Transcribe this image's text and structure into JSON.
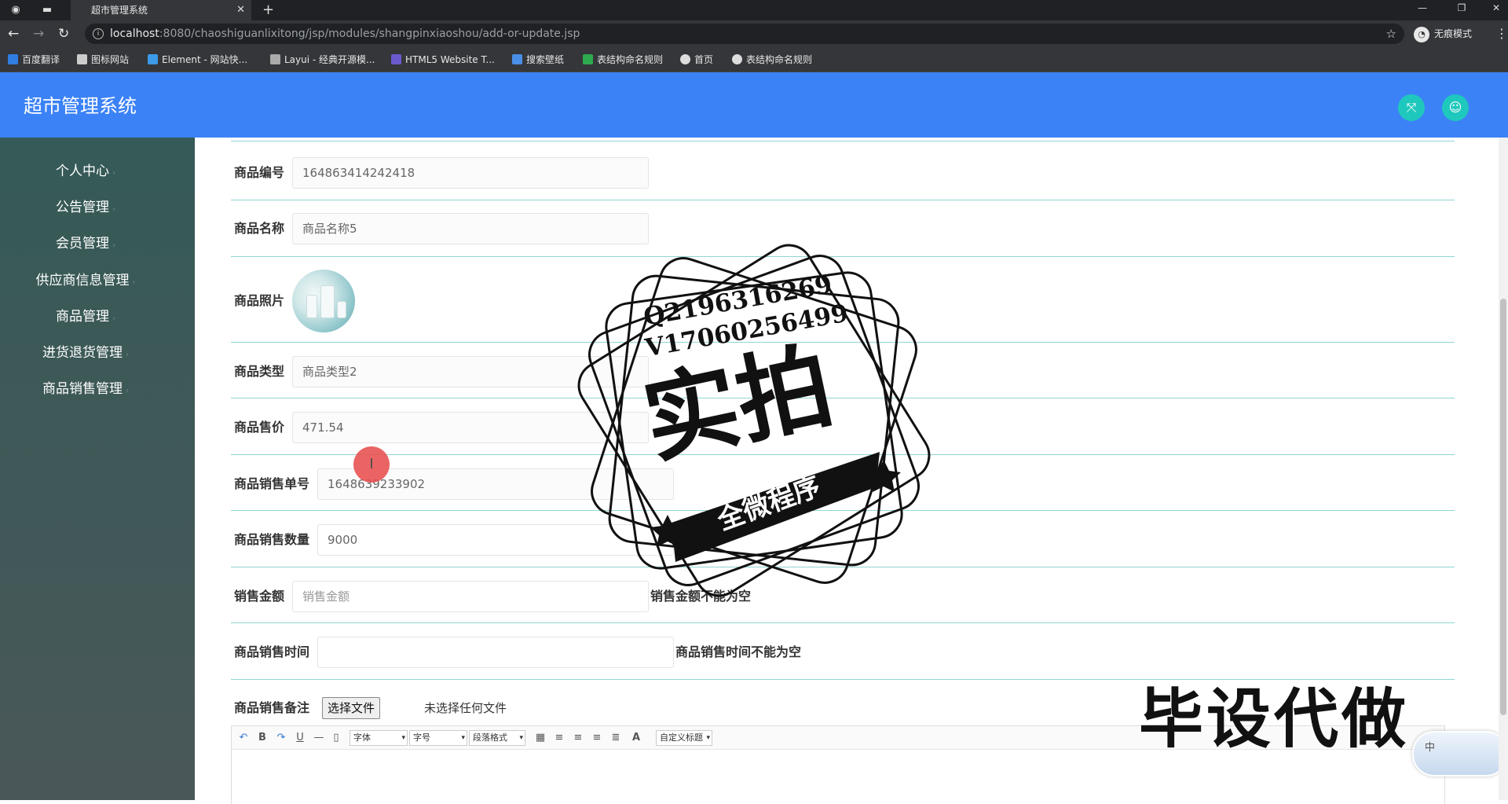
{
  "browser": {
    "tab_title": "超市管理系统",
    "tab_close": "✕",
    "url_host": "localhost",
    "url_rest": ":8080/chaoshiguanlixitong/jsp/modules/shangpinxiaoshou/add-or-update.jsp",
    "profile_label": "无痕模式",
    "bookmarks": [
      {
        "label": "百度翻译",
        "color": "#2f7de1"
      },
      {
        "label": "图标网站",
        "color": "#cccccc"
      },
      {
        "label": "Element - 网站快...",
        "color": "#3d9be9"
      },
      {
        "label": "Layui - 经典开源模...",
        "color": "#aaaaaa"
      },
      {
        "label": "HTML5 Website T...",
        "color": "#6a5acd"
      },
      {
        "label": "搜索壁纸",
        "color": "#4a8fe7"
      },
      {
        "label": "表结构命名规则",
        "color": "#2eaa4f"
      },
      {
        "label": "首页",
        "color": "#dddddd"
      },
      {
        "label": "表结构命名规则",
        "color": "#dddddd"
      }
    ]
  },
  "header": {
    "title": "超市管理系统",
    "accent": "#3b82f6",
    "button_color": "#1fc8bd"
  },
  "sidebar": {
    "items": [
      {
        "label": "个人中心"
      },
      {
        "label": "公告管理"
      },
      {
        "label": "会员管理"
      },
      {
        "label": "供应商信息管理"
      },
      {
        "label": "商品管理"
      },
      {
        "label": "进货退货管理"
      },
      {
        "label": "商品销售管理"
      }
    ]
  },
  "form": {
    "product_code": {
      "label": "商品编号",
      "value": "164863414242418"
    },
    "product_name": {
      "label": "商品名称",
      "value": "商品名称5"
    },
    "product_photo": {
      "label": "商品照片"
    },
    "product_type": {
      "label": "商品类型",
      "value": "商品类型2"
    },
    "product_price": {
      "label": "商品售价",
      "value": "471.54"
    },
    "sale_order_no": {
      "label": "商品销售单号",
      "value": "1648639233902"
    },
    "sale_quantity": {
      "label": "商品销售数量",
      "value": "9000"
    },
    "sale_amount": {
      "label": "销售金额",
      "placeholder": "销售金额",
      "error": "销售金额不能为空"
    },
    "sale_time": {
      "label": "商品销售时间",
      "value": "",
      "error": "商品销售时间不能为空"
    },
    "sale_remark": {
      "label": "商品销售备注",
      "file_button": "选择文件",
      "file_status": "未选择任何文件"
    }
  },
  "editor": {
    "font_select": "字体",
    "size_select": "字号",
    "para_select": "段落格式",
    "custom_title": "自定义标题",
    "text_color_glyph": "A"
  },
  "watermark": {
    "qq": "Q2196316269",
    "wechat": "V17060256499",
    "main": "实拍",
    "ribbon": "全微程序",
    "corner_text": "毕设代做",
    "ime_label": "中"
  }
}
